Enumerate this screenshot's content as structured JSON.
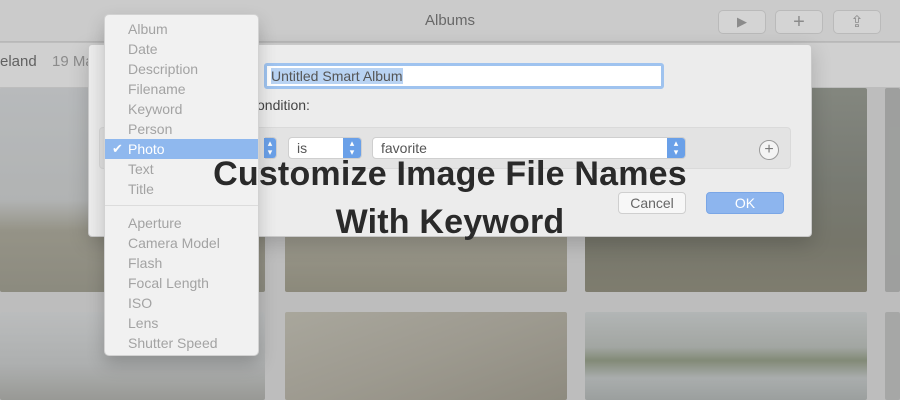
{
  "window": {
    "title": "Albums",
    "buttons": [
      {
        "name": "play-button",
        "icon": "play-icon",
        "glyph": "▶"
      },
      {
        "name": "add-button",
        "icon": "plus-icon",
        "glyph": "+"
      },
      {
        "name": "share-button",
        "icon": "share-icon",
        "glyph": "⇪"
      }
    ]
  },
  "subheader": {
    "place": "eland",
    "date": "19 Ma"
  },
  "dialog": {
    "album_name": "Untitled Smart Album",
    "condition_label": "ondition:",
    "condition": {
      "operator": "is",
      "value": "favorite"
    },
    "cancel_label": "Cancel",
    "ok_label": "OK"
  },
  "menu": {
    "group1": [
      "Album",
      "Date",
      "Description",
      "Filename",
      "Keyword",
      "Person",
      "Photo",
      "Text",
      "Title"
    ],
    "selected": "Photo",
    "group2": [
      "Aperture",
      "Camera Model",
      "Flash",
      "Focal Length",
      "ISO",
      "Lens",
      "Shutter Speed"
    ]
  },
  "headline": {
    "line1": "Customize Image File Names",
    "line2": "With Keyword"
  },
  "colors": {
    "accent": "#8fb8ee",
    "ok_button": "#8db5ee"
  }
}
